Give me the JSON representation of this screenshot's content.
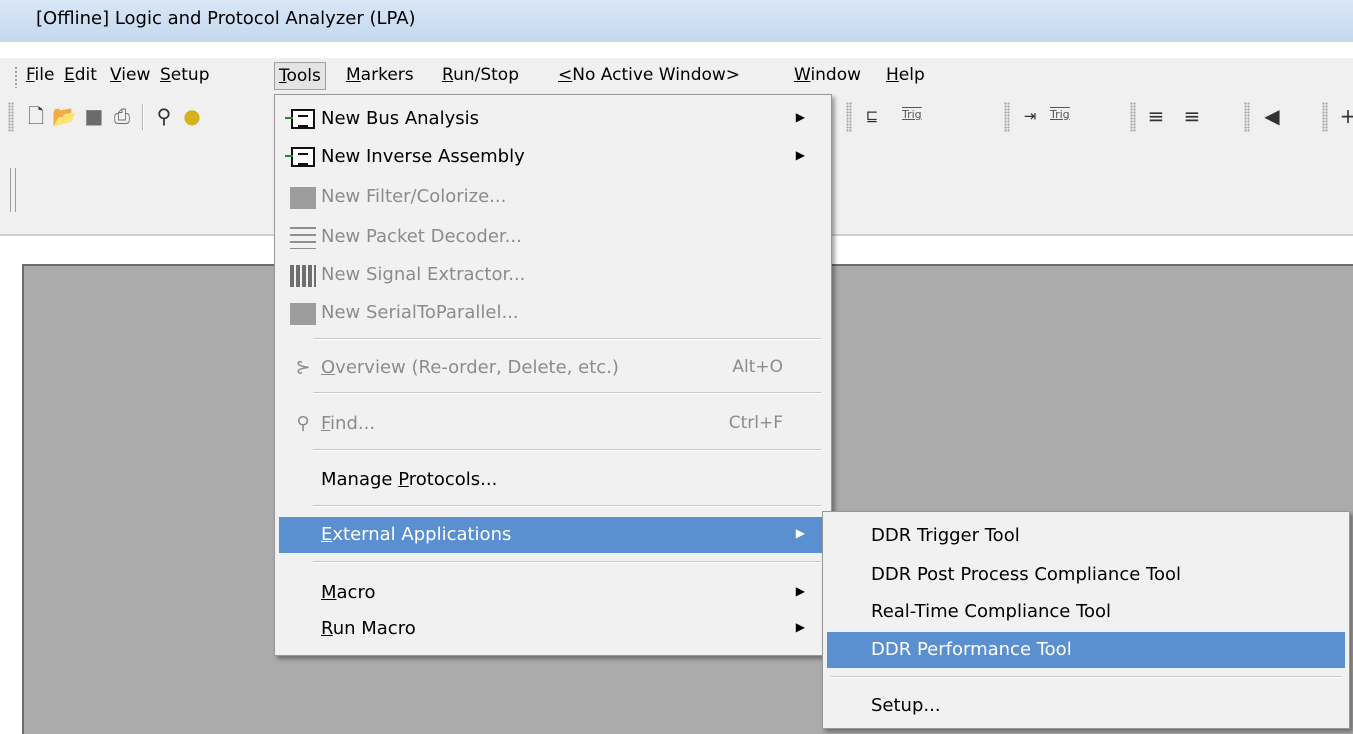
{
  "window": {
    "title": "[Offline] Logic and Protocol Analyzer (LPA)"
  },
  "menubar": {
    "items": [
      {
        "label": "File",
        "mnemonic": "F",
        "rest": "ile"
      },
      {
        "label": "Edit",
        "mnemonic": "E",
        "rest": "dit"
      },
      {
        "label": "View",
        "mnemonic": "V",
        "rest": "iew"
      },
      {
        "label": "Setup",
        "mnemonic": "S",
        "rest": "etup"
      },
      {
        "label": "Tools",
        "mnemonic": "T",
        "rest": "ools"
      },
      {
        "label": "Markers",
        "mnemonic": "M",
        "rest": "arkers"
      },
      {
        "label": "Run/Stop",
        "mnemonic": "R",
        "rest": "un/Stop"
      },
      {
        "label": "<No Active Window>",
        "mnemonic": "<",
        "rest": "No Active Window>"
      },
      {
        "label": "Window",
        "mnemonic": "W",
        "rest": "indow"
      },
      {
        "label": "Help",
        "mnemonic": "H",
        "rest": "elp"
      }
    ],
    "open_menu": "Tools"
  },
  "toolbar": {
    "trig_label": "Trig"
  },
  "tools_menu": {
    "new_bus_analysis": "New Bus Analysis",
    "new_inverse_assembly": "New Inverse Assembly",
    "new_filter": "New Filter/Colorize...",
    "new_packet_decoder": "New Packet Decoder...",
    "new_signal_extractor": "New Signal Extractor...",
    "new_serial_to_parallel": "New SerialToParallel...",
    "overview": {
      "mnemonic": "O",
      "rest": "verview (Re-order, Delete, etc.)",
      "shortcut": "Alt+O"
    },
    "find": {
      "mnemonic": "F",
      "rest": "ind...",
      "shortcut": "Ctrl+F"
    },
    "manage_protocols": {
      "before": "Manage ",
      "mnemonic": "P",
      "rest": "rotocols..."
    },
    "external_applications": {
      "mnemonic": "E",
      "rest": "xternal Applications"
    },
    "macro": {
      "mnemonic": "M",
      "rest": "acro"
    },
    "run_macro": {
      "mnemonic": "R",
      "rest": "un Macro"
    }
  },
  "external_apps_submenu": {
    "items": [
      "DDR Trigger Tool",
      "DDR Post Process Compliance Tool",
      "Real-Time Compliance Tool",
      "DDR Performance Tool"
    ],
    "highlighted": "DDR Performance Tool",
    "setup": "Setup..."
  },
  "colors": {
    "highlight": "#5a8fd0",
    "mdi_background": "#ababab",
    "titlebar": "#c4d8ee"
  }
}
